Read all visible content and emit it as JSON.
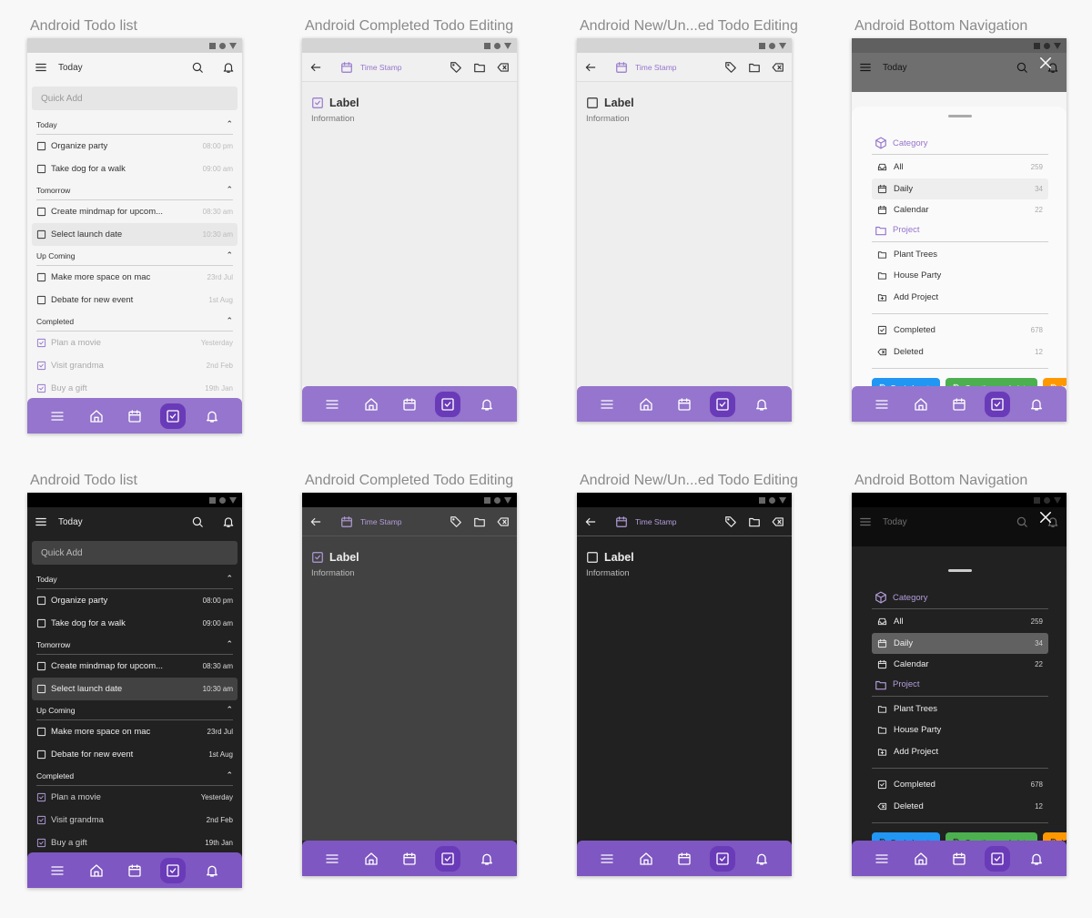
{
  "colors": {
    "accent": "#9575cd",
    "accent_dark_theme": "#7e57c2",
    "nav_active": "#6a3bb8",
    "nav_light": "#9575cd",
    "nav_dark": "#7e57c2",
    "tag_blue": "#2196f3",
    "tag_green": "#4caf50",
    "tag_orange": "#ff9800"
  },
  "screens": [
    {
      "title": "Android Todo list",
      "type": "list",
      "theme": "light"
    },
    {
      "title": "Android Completed Todo Editing",
      "type": "edit",
      "theme": "light",
      "checked": true
    },
    {
      "title": "Android New/Un...ed Todo Editing",
      "type": "edit",
      "theme": "light",
      "checked": false
    },
    {
      "title": "Android Bottom Navigation",
      "type": "sheet",
      "theme": "light"
    },
    {
      "title": "Android Todo list",
      "type": "list",
      "theme": "dark"
    },
    {
      "title": "Android Completed Todo Editing",
      "type": "edit",
      "theme": "dark",
      "checked": true
    },
    {
      "title": "Android New/Un...ed Todo Editing",
      "type": "edit",
      "theme": "dark",
      "checked": false
    },
    {
      "title": "Android Bottom Navigation",
      "type": "sheet",
      "theme": "dark"
    }
  ],
  "todo_list": {
    "appbar_title": "Today",
    "quick_add_placeholder": "Quick Add",
    "sections": [
      {
        "title": "Today",
        "items": [
          {
            "label": "Organize party",
            "time": "08:00 pm",
            "done": false
          },
          {
            "label": "Take dog for a walk",
            "time": "09:00 am",
            "done": false
          }
        ]
      },
      {
        "title": "Tomorrow",
        "items": [
          {
            "label": "Create mindmap for upcom...",
            "time": "08:30 am",
            "done": false
          },
          {
            "label": "Select launch date",
            "time": "10:30 am",
            "done": false,
            "selected": true
          }
        ]
      },
      {
        "title": "Up Coming",
        "items": [
          {
            "label": "Make more space on mac",
            "time": "23rd Jul",
            "done": false
          },
          {
            "label": "Debate for new event",
            "time": "1st Aug",
            "done": false
          }
        ]
      },
      {
        "title": "Completed",
        "items": [
          {
            "label": "Plan a movie",
            "time": "Yesterday",
            "done": true
          },
          {
            "label": "Visit grandma",
            "time": "2nd Feb",
            "done": true
          },
          {
            "label": "Buy a gift",
            "time": "19th Jan",
            "done": true
          }
        ]
      }
    ]
  },
  "edit": {
    "time_stamp": "Time Stamp",
    "label": "Label",
    "information": "Information"
  },
  "sheet": {
    "appbar_title": "Today",
    "category_title": "Category",
    "categories": [
      {
        "label": "All",
        "count": "259",
        "icon": "inbox"
      },
      {
        "label": "Daily",
        "count": "34",
        "icon": "calendar",
        "selected": true
      },
      {
        "label": "Calendar",
        "count": "22",
        "icon": "calendar"
      }
    ],
    "project_title": "Project",
    "projects": [
      {
        "label": "Plant Trees",
        "icon": "folder"
      },
      {
        "label": "House Party",
        "icon": "folder"
      },
      {
        "label": "Add Project",
        "icon": "folder-plus"
      }
    ],
    "status": [
      {
        "label": "Completed",
        "count": "678",
        "icon": "checkbox-checked"
      },
      {
        "label": "Deleted",
        "count": "12",
        "icon": "delete"
      }
    ],
    "tags": [
      {
        "label": "Basic Inputs",
        "color": "#2196f3"
      },
      {
        "label": "Creative markeintg",
        "color": "#4caf50"
      },
      {
        "label": "Vi",
        "color": "#ff9800"
      }
    ]
  },
  "bottom_nav": [
    {
      "icon": "menu"
    },
    {
      "icon": "home"
    },
    {
      "icon": "calendar"
    },
    {
      "icon": "checkbox-checked",
      "active": true
    },
    {
      "icon": "bell"
    }
  ]
}
